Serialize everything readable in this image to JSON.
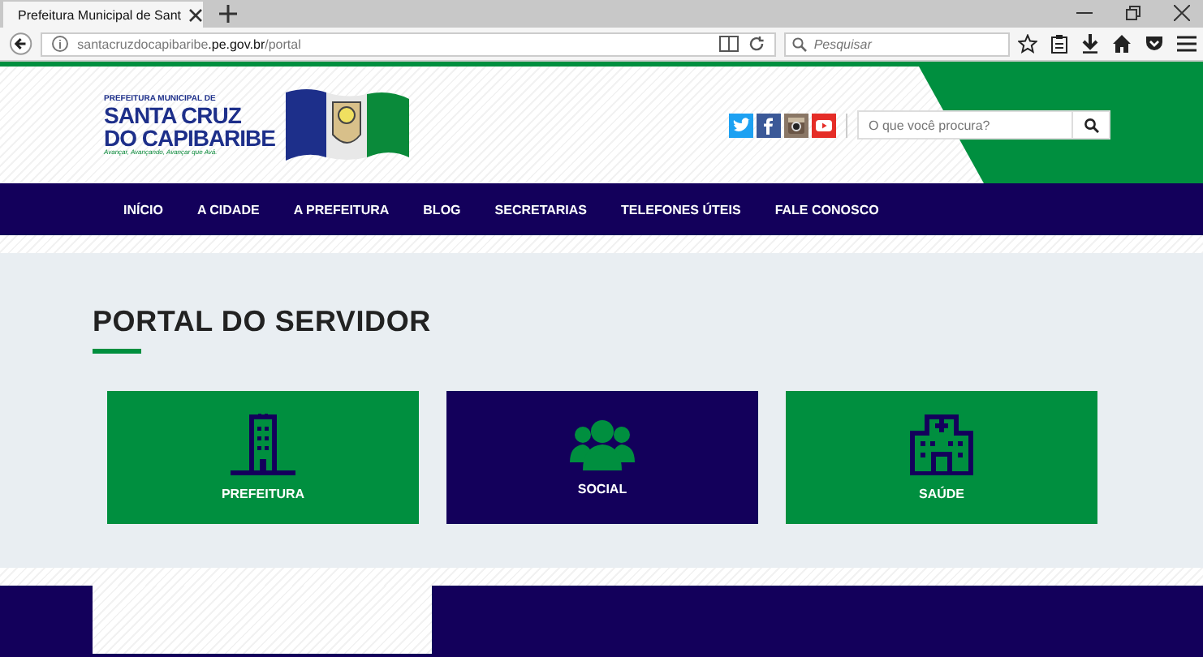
{
  "browser": {
    "tab_title": "Prefeitura Municipal de Sant",
    "url_host_prefix": "santacruzdocapibaribe",
    "url_host": ".pe.gov.br",
    "url_path": "/portal",
    "search_placeholder": "Pesquisar"
  },
  "header": {
    "logo_top": "PREFEITURA MUNICIPAL DE",
    "logo_line1": "SANTA CRUZ",
    "logo_line2": "DO CAPIBARIBE",
    "logo_slogan": "Avançar, Avançando, Avançar que Avá.",
    "search_placeholder": "O que você procura?"
  },
  "social": [
    {
      "kind": "twitter",
      "color": "#1da1f2"
    },
    {
      "kind": "facebook",
      "color": "#3b5998"
    },
    {
      "kind": "instagram",
      "color": "#8a7766"
    },
    {
      "kind": "youtube",
      "color": "#e52d27"
    }
  ],
  "nav": [
    "INÍCIO",
    "A CIDADE",
    "A PREFEITURA",
    "BLOG",
    "SECRETARIAS",
    "TELEFONES ÚTEIS",
    "FALE CONOSCO"
  ],
  "section_title": "PORTAL DO SERVIDOR",
  "cards": [
    {
      "label": "PREFEITURA",
      "kind": "building",
      "color": "#008f3f"
    },
    {
      "label": "SOCIAL",
      "kind": "people",
      "color": "#13005b"
    },
    {
      "label": "SAÚDE",
      "kind": "hospital",
      "color": "#008f3f"
    }
  ]
}
